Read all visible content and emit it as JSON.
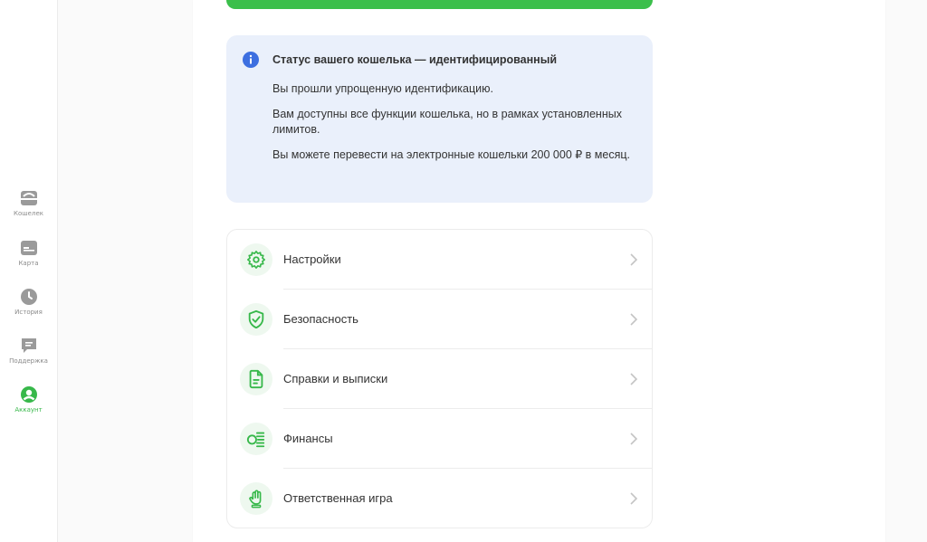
{
  "sidebar": {
    "items": [
      {
        "label": "Кошелек",
        "icon": "wallet-icon"
      },
      {
        "label": "Карта",
        "icon": "card-icon"
      },
      {
        "label": "История",
        "icon": "clock-icon"
      },
      {
        "label": "Поддержка",
        "icon": "chat-icon"
      },
      {
        "label": "Аккаунт",
        "icon": "user-icon",
        "active": true
      }
    ]
  },
  "status": {
    "title": "Статус вашего кошелька — идентифицированный",
    "lines": [
      "Вы прошли упрощенную идентификацию.",
      "Вам доступны все функции кошелька, но в рамках установленных лимитов.",
      "Вы можете перевести на электронные кошельки 200 000 ₽ в месяц."
    ]
  },
  "menu": {
    "items": [
      {
        "label": "Настройки",
        "icon": "gear-icon"
      },
      {
        "label": "Безопасность",
        "icon": "shield-check-icon"
      },
      {
        "label": "Справки и выписки",
        "icon": "document-icon"
      },
      {
        "label": "Финансы",
        "icon": "coins-icon"
      },
      {
        "label": "Ответственная игра",
        "icon": "hand-stop-icon"
      }
    ]
  },
  "colors": {
    "accent": "#3bbf4b",
    "info_bg": "#eaf0fb",
    "info_icon": "#3d6fe0",
    "icon_bg": "#eef8ef",
    "inactive_icon": "#9a9a9a"
  }
}
